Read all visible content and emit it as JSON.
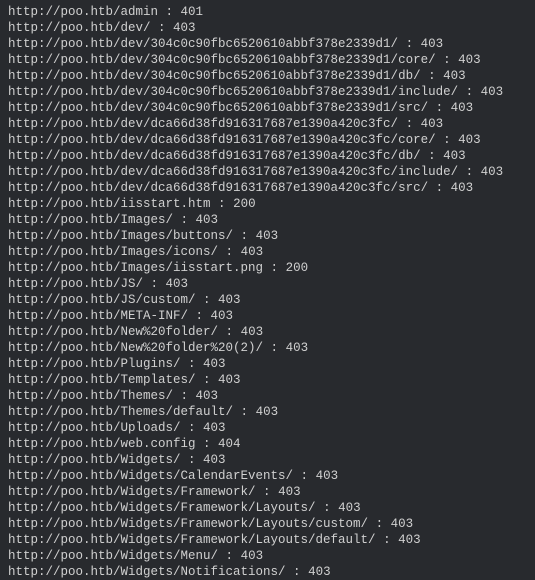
{
  "lines": [
    {
      "url": "http://poo.htb/admin",
      "status": "401"
    },
    {
      "url": "http://poo.htb/dev/",
      "status": "403"
    },
    {
      "url": "http://poo.htb/dev/304c0c90fbc6520610abbf378e2339d1/",
      "status": "403"
    },
    {
      "url": "http://poo.htb/dev/304c0c90fbc6520610abbf378e2339d1/core/",
      "status": "403"
    },
    {
      "url": "http://poo.htb/dev/304c0c90fbc6520610abbf378e2339d1/db/",
      "status": "403"
    },
    {
      "url": "http://poo.htb/dev/304c0c90fbc6520610abbf378e2339d1/include/",
      "status": "403"
    },
    {
      "url": "http://poo.htb/dev/304c0c90fbc6520610abbf378e2339d1/src/",
      "status": "403"
    },
    {
      "url": "http://poo.htb/dev/dca66d38fd916317687e1390a420c3fc/",
      "status": "403"
    },
    {
      "url": "http://poo.htb/dev/dca66d38fd916317687e1390a420c3fc/core/",
      "status": "403"
    },
    {
      "url": "http://poo.htb/dev/dca66d38fd916317687e1390a420c3fc/db/",
      "status": "403"
    },
    {
      "url": "http://poo.htb/dev/dca66d38fd916317687e1390a420c3fc/include/",
      "status": "403"
    },
    {
      "url": "http://poo.htb/dev/dca66d38fd916317687e1390a420c3fc/src/",
      "status": "403"
    },
    {
      "url": "http://poo.htb/iisstart.htm",
      "status": "200"
    },
    {
      "url": "http://poo.htb/Images/",
      "status": "403"
    },
    {
      "url": "http://poo.htb/Images/buttons/",
      "status": "403"
    },
    {
      "url": "http://poo.htb/Images/icons/",
      "status": "403"
    },
    {
      "url": "http://poo.htb/Images/iisstart.png",
      "status": "200"
    },
    {
      "url": "http://poo.htb/JS/",
      "status": "403"
    },
    {
      "url": "http://poo.htb/JS/custom/",
      "status": "403"
    },
    {
      "url": "http://poo.htb/META-INF/",
      "status": "403"
    },
    {
      "url": "http://poo.htb/New%20folder/",
      "status": "403"
    },
    {
      "url": "http://poo.htb/New%20folder%20(2)/",
      "status": "403"
    },
    {
      "url": "http://poo.htb/Plugins/",
      "status": "403"
    },
    {
      "url": "http://poo.htb/Templates/",
      "status": "403"
    },
    {
      "url": "http://poo.htb/Themes/",
      "status": "403"
    },
    {
      "url": "http://poo.htb/Themes/default/",
      "status": "403"
    },
    {
      "url": "http://poo.htb/Uploads/",
      "status": "403"
    },
    {
      "url": "http://poo.htb/web.config",
      "status": "404"
    },
    {
      "url": "http://poo.htb/Widgets/",
      "status": "403"
    },
    {
      "url": "http://poo.htb/Widgets/CalendarEvents/",
      "status": "403"
    },
    {
      "url": "http://poo.htb/Widgets/Framework/",
      "status": "403"
    },
    {
      "url": "http://poo.htb/Widgets/Framework/Layouts/",
      "status": "403"
    },
    {
      "url": "http://poo.htb/Widgets/Framework/Layouts/custom/",
      "status": "403"
    },
    {
      "url": "http://poo.htb/Widgets/Framework/Layouts/default/",
      "status": "403"
    },
    {
      "url": "http://poo.htb/Widgets/Menu/",
      "status": "403"
    },
    {
      "url": "http://poo.htb/Widgets/Notifications/",
      "status": "403"
    }
  ],
  "separator": " : "
}
